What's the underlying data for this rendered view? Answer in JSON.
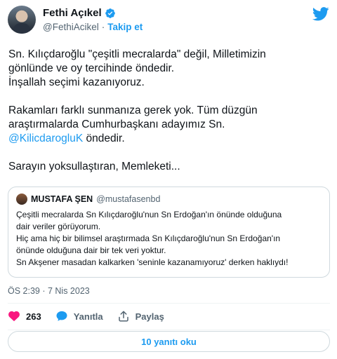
{
  "author": {
    "name": "Fethi Açıkel",
    "handle": "@FethiAcikel",
    "separator": "·",
    "follow_label": "Takip et"
  },
  "tweet": {
    "paragraphs": [
      [
        "Sn. Kılıçdaroğlu \"çeşitli mecralarda\" değil, Milletimizin",
        "gönlünde ve oy tercihinde öndedir.",
        "İnşallah seçimi kazanıyoruz."
      ],
      [
        "Rakamları farklı sunmanıza gerek yok. Tüm düzgün",
        "araştırmalarda Cumhurbaşkanı adayımız Sn."
      ],
      [
        "Sarayın yoksullaştıran, Memleketi..."
      ]
    ],
    "mention": "@KilicdarogluK",
    "mention_suffix": " öndedir."
  },
  "quote": {
    "name": "MUSTAFA ŞEN",
    "handle": "@mustafasenbd",
    "lines": [
      "Çeşitli mecralarda Sn Kılıçdaroğlu'nun Sn Erdoğan'ın önünde olduğuna",
      "dair veriler görüyorum.",
      "Hiç ama hiç bir bilimsel araştırmada Sn Kılıçdaroğlu'nun Sn Erdoğan'ın",
      "önünde olduğuna dair bir tek veri yoktur.",
      "Sn Akşener masadan kalkarken 'seninle kazanamıyoruz' derken haklıydı!"
    ]
  },
  "timestamp": "ÖS 2:39 · 7 Nis 2023",
  "actions": {
    "like_count": "263",
    "reply_label": "Yanıtla",
    "share_label": "Paylaş"
  },
  "replies_button": "10 yanıtı oku",
  "colors": {
    "accent": "#1d9bf0",
    "like": "#f91880",
    "text": "#0f1419",
    "secondary": "#536471",
    "border": "#cfd9de"
  },
  "icons": {
    "verified": "verified-badge-icon",
    "brand": "twitter-bird-icon",
    "like": "heart-icon",
    "reply": "reply-bubble-icon",
    "share": "share-upload-icon"
  }
}
